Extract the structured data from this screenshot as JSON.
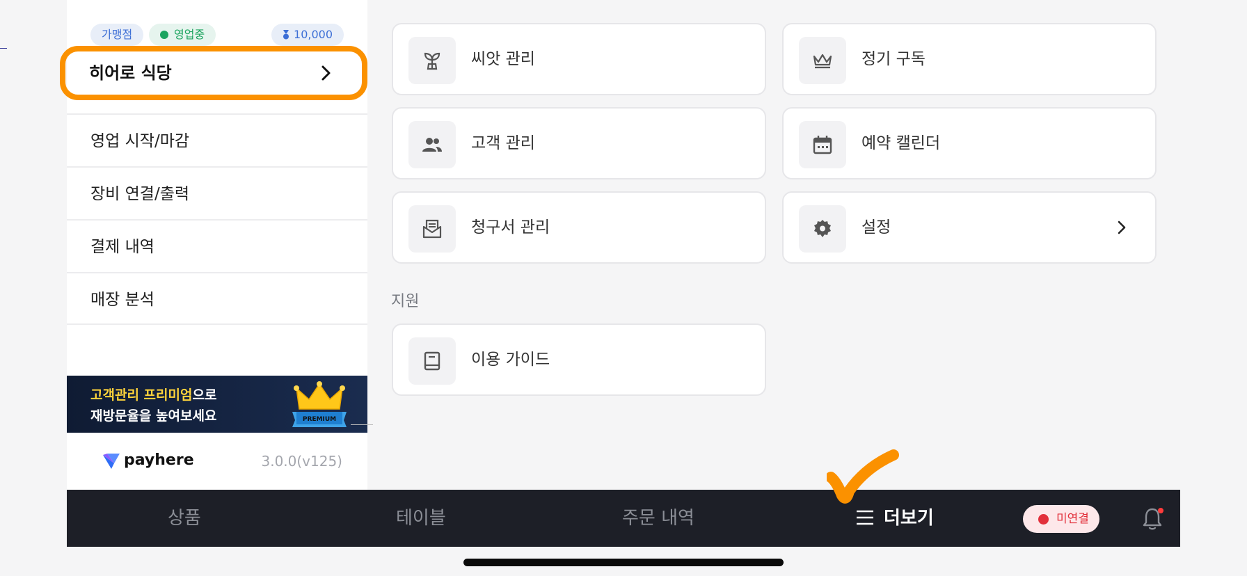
{
  "sidebar": {
    "badges": {
      "franchise": "가맹점",
      "status": "영업중",
      "points": "10,000"
    },
    "store_name": "히어로 식당",
    "menu": [
      {
        "label": "영업 시작/마감"
      },
      {
        "label": "장비 연결/출력"
      },
      {
        "label": "결제 내역"
      },
      {
        "label": "매장 분석"
      }
    ],
    "promo": {
      "highlight": "고객관리 프리미엄",
      "line1_rest": "으로",
      "line2": "재방문율을 높여보세요",
      "crown_text": "PREMIUM"
    },
    "brand": "payhere",
    "version": "3.0.0(v125)"
  },
  "tiles": [
    {
      "label": "씨앗 관리",
      "icon": "sprout-icon"
    },
    {
      "label": "정기 구독",
      "icon": "crown-icon"
    },
    {
      "label": "고객 관리",
      "icon": "people-icon"
    },
    {
      "label": "예약 캘린더",
      "icon": "calendar-icon"
    },
    {
      "label": "청구서 관리",
      "icon": "invoice-mail-icon"
    },
    {
      "label": "설정",
      "icon": "gear-icon"
    }
  ],
  "support": {
    "title": "지원",
    "guide": {
      "label": "이용 가이드",
      "icon": "book-icon"
    }
  },
  "tabbar": {
    "products": "상품",
    "tables": "테이블",
    "orders": "주문 내역",
    "more": "더보기",
    "connection": "미연결"
  },
  "colors": {
    "highlight_outline": "#fb9100",
    "tabbar_bg": "#1d1f27",
    "status_green": "#1ca45f",
    "disconnect_red": "#e2303b"
  }
}
